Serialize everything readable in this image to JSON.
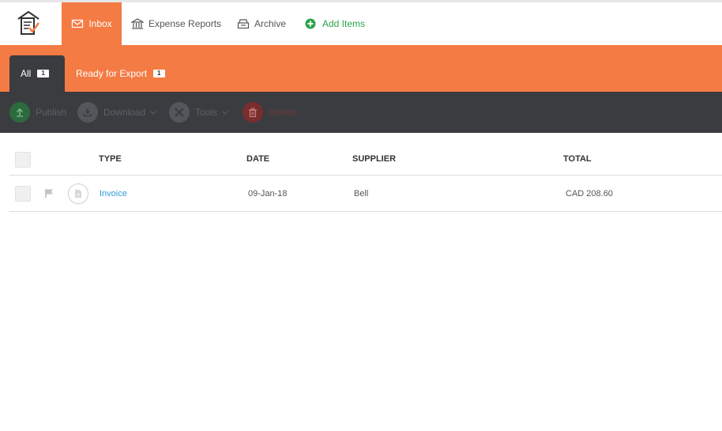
{
  "nav": {
    "inbox": "Inbox",
    "expense_reports": "Expense Reports",
    "archive": "Archive",
    "add_items": "Add Items",
    "icons": [
      "receipt-logo-icon",
      "envelope-icon",
      "bank-icon",
      "archive-tray-icon",
      "plus-circle-icon"
    ]
  },
  "tabs": {
    "all": {
      "label": "All",
      "count": "1"
    },
    "ready": {
      "label": "Ready for Export",
      "count": "1"
    }
  },
  "toolbar": {
    "publish": "Publish",
    "download": "Download",
    "tools": "Tools",
    "delete": "Delete"
  },
  "table": {
    "headers": {
      "type": "TYPE",
      "date": "DATE",
      "supplier": "SUPPLIER",
      "total": "TOTAL"
    },
    "rows": [
      {
        "type": "Invoice",
        "date": "09-Jan-18",
        "supplier": "Bell",
        "total": "CAD 208.60"
      }
    ]
  },
  "colors": {
    "accent": "#f47b44",
    "toolbar_bg": "#3b3c40",
    "add_green": "#2aa34a",
    "link_blue": "#2f9bd6"
  }
}
